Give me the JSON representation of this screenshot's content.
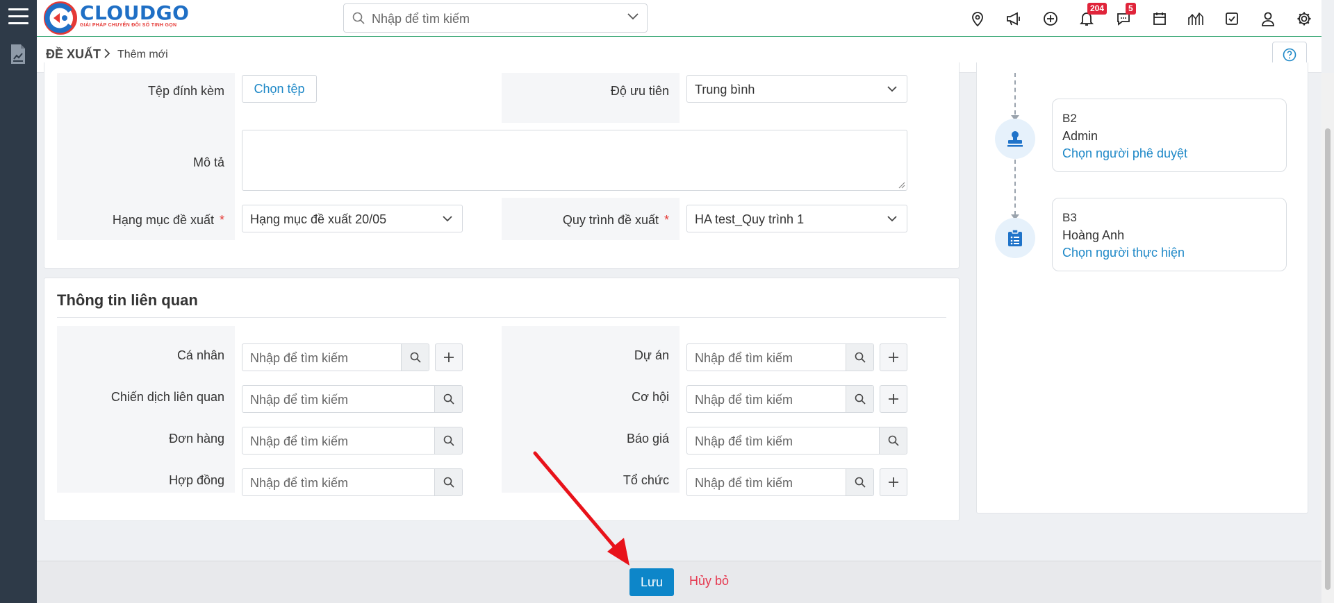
{
  "app": {
    "logo_text": "CLOUDGO",
    "logo_tagline": "GIẢI PHÁP CHUYỂN ĐỔI SỐ TINH GỌN"
  },
  "search": {
    "placeholder": "Nhập để tìm kiếm"
  },
  "top_icons": {
    "notifications_count": "204",
    "messages_count": "5"
  },
  "breadcrumb": {
    "module": "ĐỀ XUẤT",
    "page": "Thêm mới"
  },
  "form": {
    "attachment_label": "Tệp đính kèm",
    "attachment_button": "Chọn tệp",
    "priority_label": "Độ ưu tiên",
    "priority_value": "Trung bình",
    "description_label": "Mô tả",
    "category_label": "Hạng mục đề xuất",
    "category_value": "Hạng mục đề xuất 20/05",
    "process_label": "Quy trình đề xuất",
    "process_value": "HA test_Quy trình 1",
    "required_mark": "*"
  },
  "related": {
    "title": "Thông tin liên quan",
    "search_placeholder": "Nhập để tìm kiếm",
    "left_fields": [
      {
        "label": "Cá nhân"
      },
      {
        "label": "Chiến dịch liên quan"
      },
      {
        "label": "Đơn hàng"
      },
      {
        "label": "Hợp đồng"
      }
    ],
    "right_fields": [
      {
        "label": "Dự án"
      },
      {
        "label": "Cơ hội"
      },
      {
        "label": "Báo giá"
      },
      {
        "label": "Tổ chức"
      }
    ]
  },
  "workflow": {
    "steps": [
      {
        "code": "B2",
        "name": "Admin",
        "action": "Chọn người phê duyệt",
        "icon": "stamp-icon"
      },
      {
        "code": "B3",
        "name": "Hoàng Anh",
        "action": "Chọn người thực hiện",
        "icon": "clipboard-list-icon"
      }
    ]
  },
  "footer": {
    "save_label": "Lưu",
    "cancel_label": "Hủy bỏ"
  },
  "colors": {
    "brand": "#1f6fc5",
    "accent": "#0d86c9",
    "danger": "#e53950",
    "rail": "#2e3a48"
  }
}
